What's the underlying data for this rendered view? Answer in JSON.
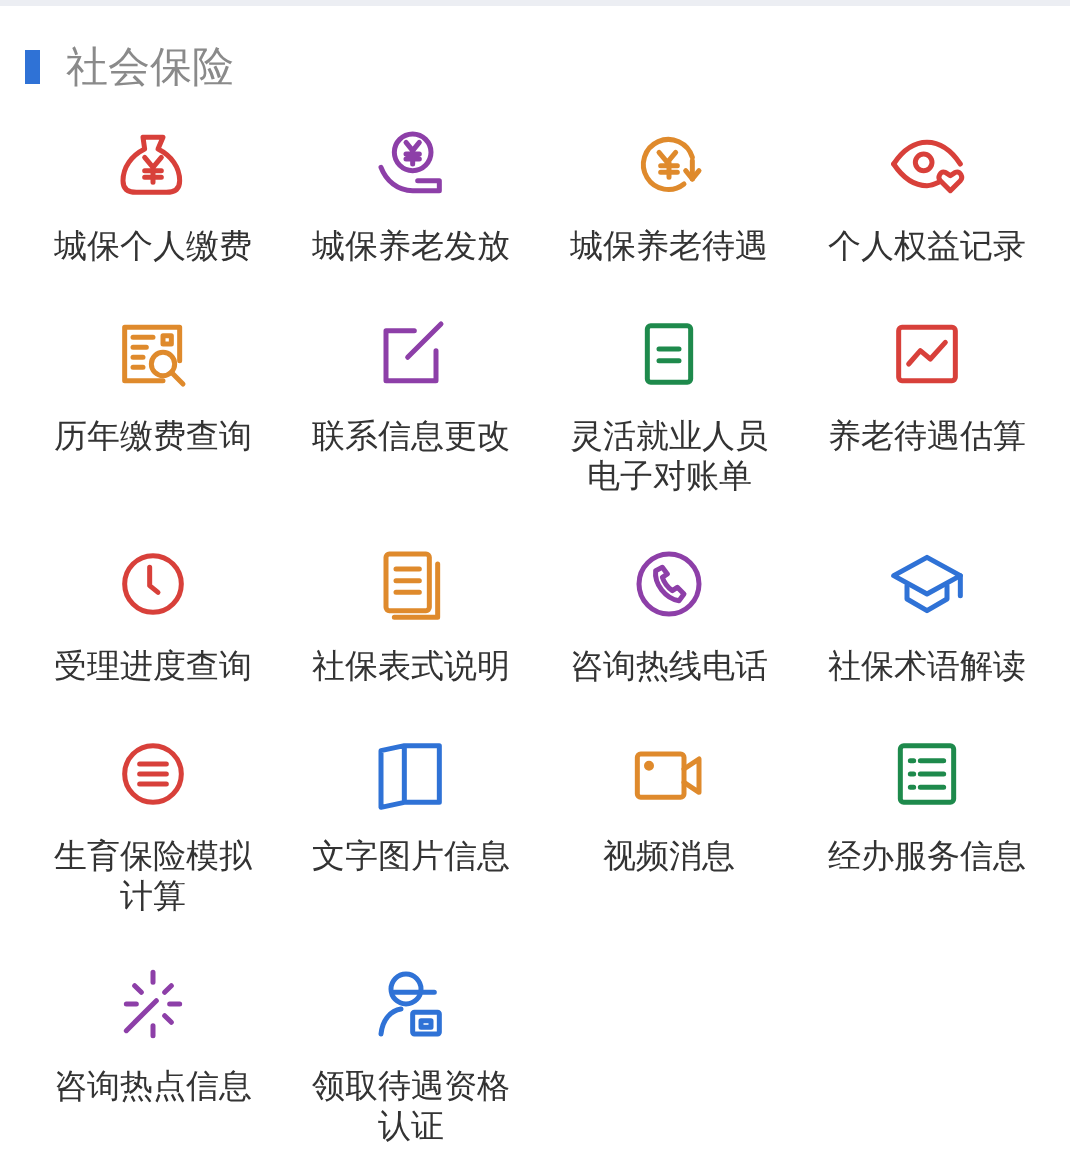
{
  "section": {
    "title": "社会保险"
  },
  "items": [
    {
      "label": "城保个人缴费",
      "color": "#d8403a"
    },
    {
      "label": "城保养老发放",
      "color": "#8d3fa8"
    },
    {
      "label": "城保养老待遇",
      "color": "#df8a2c"
    },
    {
      "label": "个人权益记录",
      "color": "#d8403a"
    },
    {
      "label": "历年缴费查询",
      "color": "#df8a2c"
    },
    {
      "label": "联系信息更改",
      "color": "#8d3fa8"
    },
    {
      "label": "灵活就业人员电子对账单",
      "color": "#1e8a4c"
    },
    {
      "label": "养老待遇估算",
      "color": "#d8403a"
    },
    {
      "label": "受理进度查询",
      "color": "#d8403a"
    },
    {
      "label": "社保表式说明",
      "color": "#df8a2c"
    },
    {
      "label": "咨询热线电话",
      "color": "#8d3fa8"
    },
    {
      "label": "社保术语解读",
      "color": "#2f72d6"
    },
    {
      "label": "生育保险模拟计算",
      "color": "#d8403a"
    },
    {
      "label": "文字图片信息",
      "color": "#2f72d6"
    },
    {
      "label": "视频消息",
      "color": "#df8a2c"
    },
    {
      "label": "经办服务信息",
      "color": "#1e8a4c"
    },
    {
      "label": "咨询热点信息",
      "color": "#8d3fa8"
    },
    {
      "label": "领取待遇资格认证",
      "color": "#2f72d6"
    }
  ]
}
